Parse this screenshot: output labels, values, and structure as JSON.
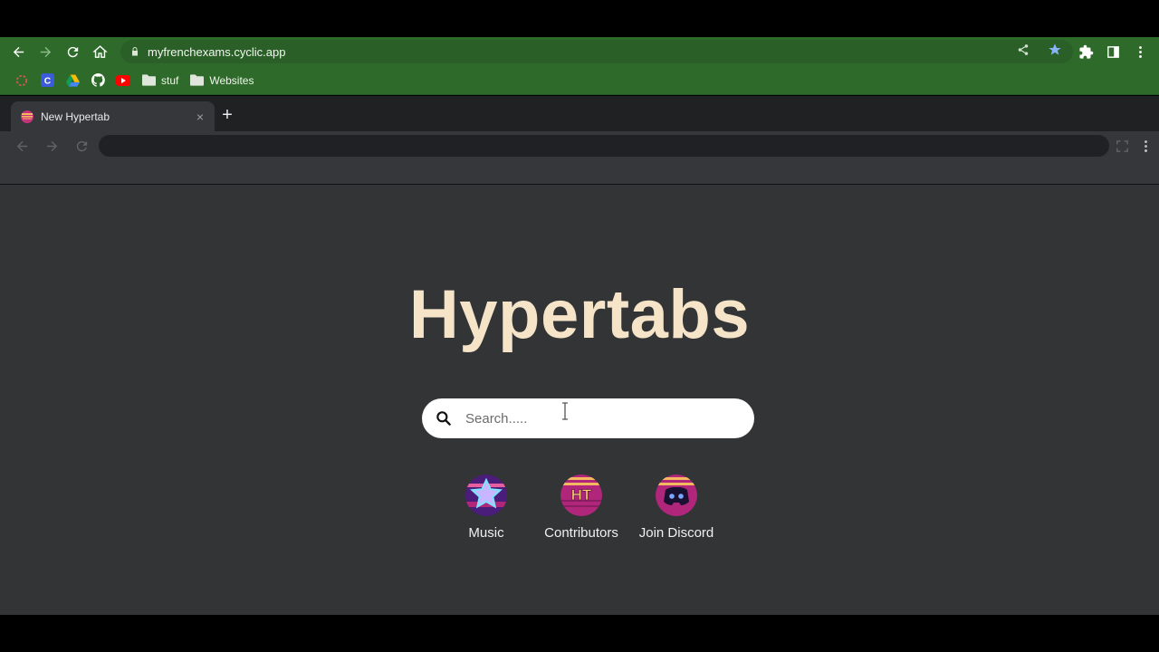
{
  "browser": {
    "url": "myfrenchexams.cyclic.app"
  },
  "bookmarks": [
    {
      "label": "",
      "icon": "circle-icon"
    },
    {
      "label": "",
      "icon": "c-logo-icon"
    },
    {
      "label": "",
      "icon": "google-drive-icon"
    },
    {
      "label": "",
      "icon": "github-icon"
    },
    {
      "label": "",
      "icon": "youtube-icon"
    },
    {
      "label": "stuf",
      "icon": "folder-icon"
    },
    {
      "label": "Websites",
      "icon": "folder-icon"
    }
  ],
  "inner_browser": {
    "tab_title": "New Hypertab",
    "new_tab_symbol": "+",
    "close_symbol": "×"
  },
  "page": {
    "brand": "Hypertabs",
    "search_placeholder": "Search.....",
    "shortcuts": [
      {
        "label": "Music",
        "icon": "star-icon"
      },
      {
        "label": "Contributors",
        "icon": "ht-logo-icon"
      },
      {
        "label": "Join Discord",
        "icon": "discord-icon"
      }
    ]
  },
  "colors": {
    "chrome_green": "#2e6b2a",
    "brand_text": "#f6e4c8",
    "page_bg": "#323436"
  }
}
